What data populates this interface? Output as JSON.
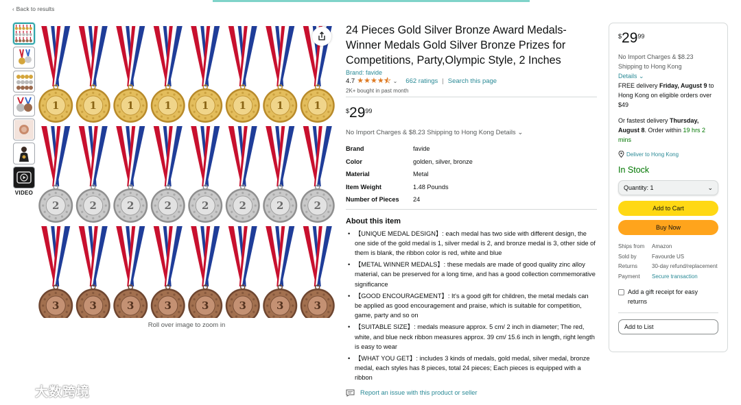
{
  "nav": {
    "back_label": "Back to results"
  },
  "gallery": {
    "video_label": "VIDEO",
    "zoom_hint": "Roll over image to zoom in",
    "rows": [
      {
        "medal": "gold",
        "number": "1"
      },
      {
        "medal": "silver",
        "number": "2"
      },
      {
        "medal": "bronze",
        "number": "3"
      }
    ],
    "medals_per_row": 8
  },
  "product": {
    "title": "24 Pieces Gold Silver Bronze Award Medals-Winner Medals Gold Silver Bronze Prizes for Competitions, Party,Olympic Style, 2 Inches",
    "brand": "Brand: favide",
    "rating": "4.7",
    "stars": 4.5,
    "ratings_count": "662 ratings",
    "search_link": "Search this page",
    "bought": "2K+ bought in past month",
    "price": {
      "symbol": "$",
      "whole": "29",
      "fraction": "99"
    },
    "import_text": "No Import Charges & $8.23 Shipping to Hong Kong",
    "import_details": "Details",
    "specs": [
      {
        "key": "Brand",
        "value": "favide"
      },
      {
        "key": "Color",
        "value": "golden, silver, bronze"
      },
      {
        "key": "Material",
        "value": "Metal"
      },
      {
        "key": "Item Weight",
        "value": "1.48 Pounds"
      },
      {
        "key": "Number of Pieces",
        "value": "24"
      }
    ],
    "about_heading": "About this item",
    "bullets": [
      "【UNIQUE MEDAL DESIGN】: each medal has two side with different design, the one side of the gold medal is 1, silver medal is 2, and bronze medal is 3, other side of them is blank, the ribbon color is red, white and blue",
      "【METAL WINNER MEDALS】: these medals are made of good quality zinc alloy material, can be preserved for a long time, and has a good collection commemorative significance",
      "【GOOD ENCOURAGEMENT】: It's a good gift for children, the metal medals can be applied as good encouragement and praise, which is suitable for competition, game, party and so on",
      "【SUITABLE SIZE】: medals measure approx. 5 cm/ 2 inch in diameter; The red, white, and blue neck ribbon measures approx. 39 cm/ 15.6 inch in length, right length is easy to wear",
      "【WHAT YOU GET】: includes 3 kinds of medals, gold medal, silver medal, bronze medal, each styles has 8 pieces, total 24 pieces; Each pieces is equipped with a ribbon"
    ],
    "report_label": "Report an issue with this product or seller"
  },
  "buybox": {
    "price": {
      "symbol": "$",
      "whole": "29",
      "fraction": "99"
    },
    "shipping": "No Import Charges & $8.23 Shipping to Hong Kong",
    "details": "Details",
    "free_prefix": "FREE delivery ",
    "free_date": "Friday, August 9",
    "free_suffix": " to Hong Kong on eligible orders over $49",
    "fast_prefix": "Or fastest delivery ",
    "fast_date": "Thursday, August 8",
    "fast_mid": ". Order within ",
    "fast_time": "19 hrs 2 mins",
    "deliver_to": "Deliver to Hong Kong",
    "stock": "In Stock",
    "quantity": "Quantity: 1",
    "add_to_cart": "Add to Cart",
    "buy_now": "Buy Now",
    "info": [
      {
        "key": "Ships from",
        "value": "Amazon",
        "link": false
      },
      {
        "key": "Sold by",
        "value": "Favourde US",
        "link": false
      },
      {
        "key": "Returns",
        "value": "30-day refund/replacement",
        "link": false
      },
      {
        "key": "Payment",
        "value": "Secure transaction",
        "link": true
      }
    ],
    "gift_label": "Add a gift receipt for easy returns",
    "add_to_list": "Add to List"
  },
  "watermark": "大数跨境",
  "colors": {
    "link": "#2a8a96",
    "star": "#de7921",
    "in_stock": "#007600",
    "cart_button": "#ffd814",
    "buy_button": "#ffa41c",
    "gold": "#d4a53c",
    "silver": "#b8b8b8",
    "bronze": "#9c6b4e"
  }
}
